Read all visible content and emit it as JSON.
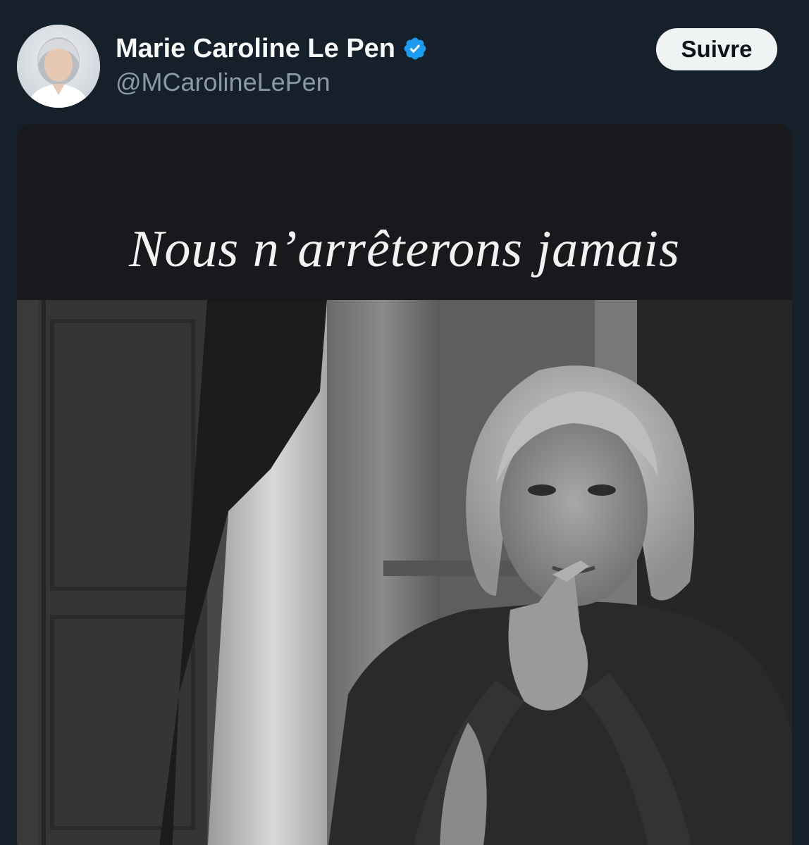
{
  "post": {
    "author": {
      "display_name": "Marie Caroline Le Pen",
      "handle": "@MCarolineLePen",
      "verified": true,
      "avatar_icon": "profile-photo"
    },
    "follow_label": "Suivre",
    "media": {
      "headline": "Nous n’arrêterons jamais",
      "photo_icon": "black-and-white-portrait-photo"
    }
  },
  "colors": {
    "background": "#15202b",
    "name_text": "#f7f9f9",
    "handle_text": "#8b98a5",
    "verified_badge": "#1d9bf0",
    "follow_button_bg": "#eff3f4",
    "follow_button_text": "#0f1419"
  }
}
